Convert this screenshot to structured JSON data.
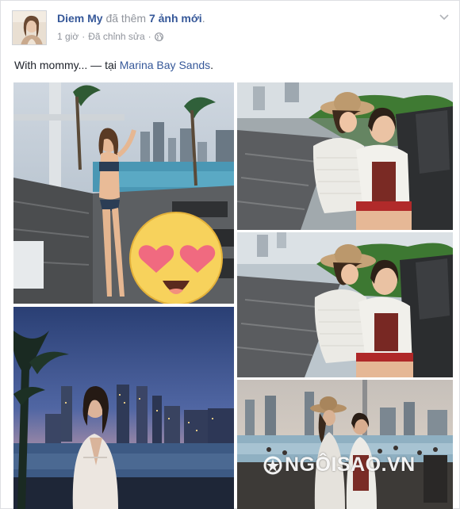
{
  "post": {
    "author": "Diem My",
    "action_text": "đã thêm",
    "photo_count_text": "7 ảnh mới",
    "period": ".",
    "time": "1 giờ",
    "separator": "·",
    "edited": "Đã chỉnh sửa",
    "privacy_icon": "globe-icon",
    "caption_text": "With mommy... — tại",
    "location": "Marina Bay Sands",
    "caption_end": "."
  },
  "photos": [
    {
      "description": "Woman in bikini at rooftop infinity pool",
      "sticker": "heart-eyes-emoji"
    },
    {
      "description": "Two women hugging on poolside lounger"
    },
    {
      "description": "Two women hugging on poolside lounger, second shot"
    },
    {
      "description": "Woman in white robe at infinity pool at dusk"
    },
    {
      "description": "Two women standing at infinity pool edge"
    }
  ],
  "watermark": {
    "text": "NGÔISAO.VN"
  },
  "colors": {
    "link": "#365899",
    "meta": "#90949c",
    "text": "#1d2129",
    "border": "#dddfe2"
  }
}
